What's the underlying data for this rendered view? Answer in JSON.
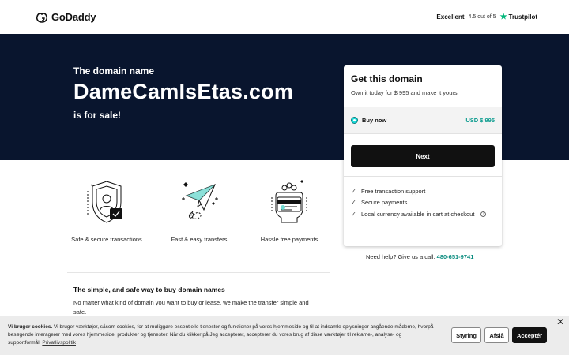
{
  "header": {
    "brand": "GoDaddy",
    "trust_rating": "Excellent",
    "trust_score": "4.5 out of 5",
    "trust_brand": "Trustpilot"
  },
  "hero": {
    "kicker": "The domain name",
    "domain": "DameCamIsEtas.com",
    "sale_text": "is for sale!"
  },
  "card": {
    "title": "Get this domain",
    "subtitle": "Own it today for $ 995 and make it yours.",
    "buy_label": "Buy now",
    "buy_price": "USD $ 995",
    "next_label": "Next",
    "features": [
      "Free transaction support",
      "Secure payments",
      "Local currency available in cart at checkout"
    ]
  },
  "help": {
    "text": "Need help? Give us a call.",
    "phone": "480-651-9741"
  },
  "benefits": [
    "Safe & secure transactions",
    "Fast & easy transfers",
    "Hassle free payments"
  ],
  "info": {
    "title": "The simple, and safe way to buy domain names",
    "body": "No matter what kind of domain you want to buy or lease, we make the transfer simple and safe."
  },
  "cookie": {
    "title": "Vi bruger cookies.",
    "body": "Vi bruger værktøjer, såsom cookies, for at muliggøre essentielle tjenester og funktioner på vores hjemmeside og til at indsamle oplysninger angående måderne, hvorpå besøgende interagerer med vores hjemmeside, produkter og tjenester. Når du klikker på Jeg accepterer, accepterer du vores brug af disse værktøjer til reklame-, analyse- og supportformål.",
    "link": "Privatlivspolitik",
    "manage_label": "Styring",
    "reject_label": "Afslå",
    "accept_label": "Acceptér",
    "close_glyph": "✕"
  },
  "colors": {
    "hero_bg": "#09152e",
    "accent": "#0a9b8e",
    "radio": "#1bdbdb",
    "trustpilot": "#00b67a"
  },
  "icons": {
    "check": "✓",
    "star": "★",
    "info": "i"
  }
}
